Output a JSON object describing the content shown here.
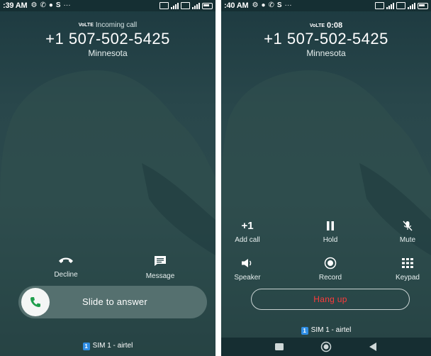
{
  "left": {
    "status_time": ":39 AM",
    "volte": "VoLTE",
    "call_status": "Incoming call",
    "number": "+1 507-502-5425",
    "location": "Minnesota",
    "decline_label": "Decline",
    "message_label": "Message",
    "slide_label": "Slide to answer",
    "sim_badge": "1",
    "sim_label": "SIM 1 - airtel",
    "icons": {
      "decline": "phone-hangup-icon",
      "message": "message-icon",
      "answer": "phone-icon"
    }
  },
  "right": {
    "status_time": ":40 AM",
    "volte": "VoLTE",
    "call_timer": "0:08",
    "number": "+1 507-502-5425",
    "location": "Minnesota",
    "controls": {
      "add_call": {
        "label": "Add call",
        "glyph": "+1"
      },
      "hold": {
        "label": "Hold"
      },
      "mute": {
        "label": "Mute"
      },
      "speaker": {
        "label": "Speaker"
      },
      "record": {
        "label": "Record"
      },
      "keypad": {
        "label": "Keypad"
      }
    },
    "hangup_label": "Hang up",
    "sim_badge": "1",
    "sim_label": "SIM 1 - airtel"
  },
  "colors": {
    "background": "#2c4a4d",
    "answer_icon": "#1f9e4c",
    "hangup_text": "#ff3b3b",
    "sim_badge": "#2f8de3"
  }
}
